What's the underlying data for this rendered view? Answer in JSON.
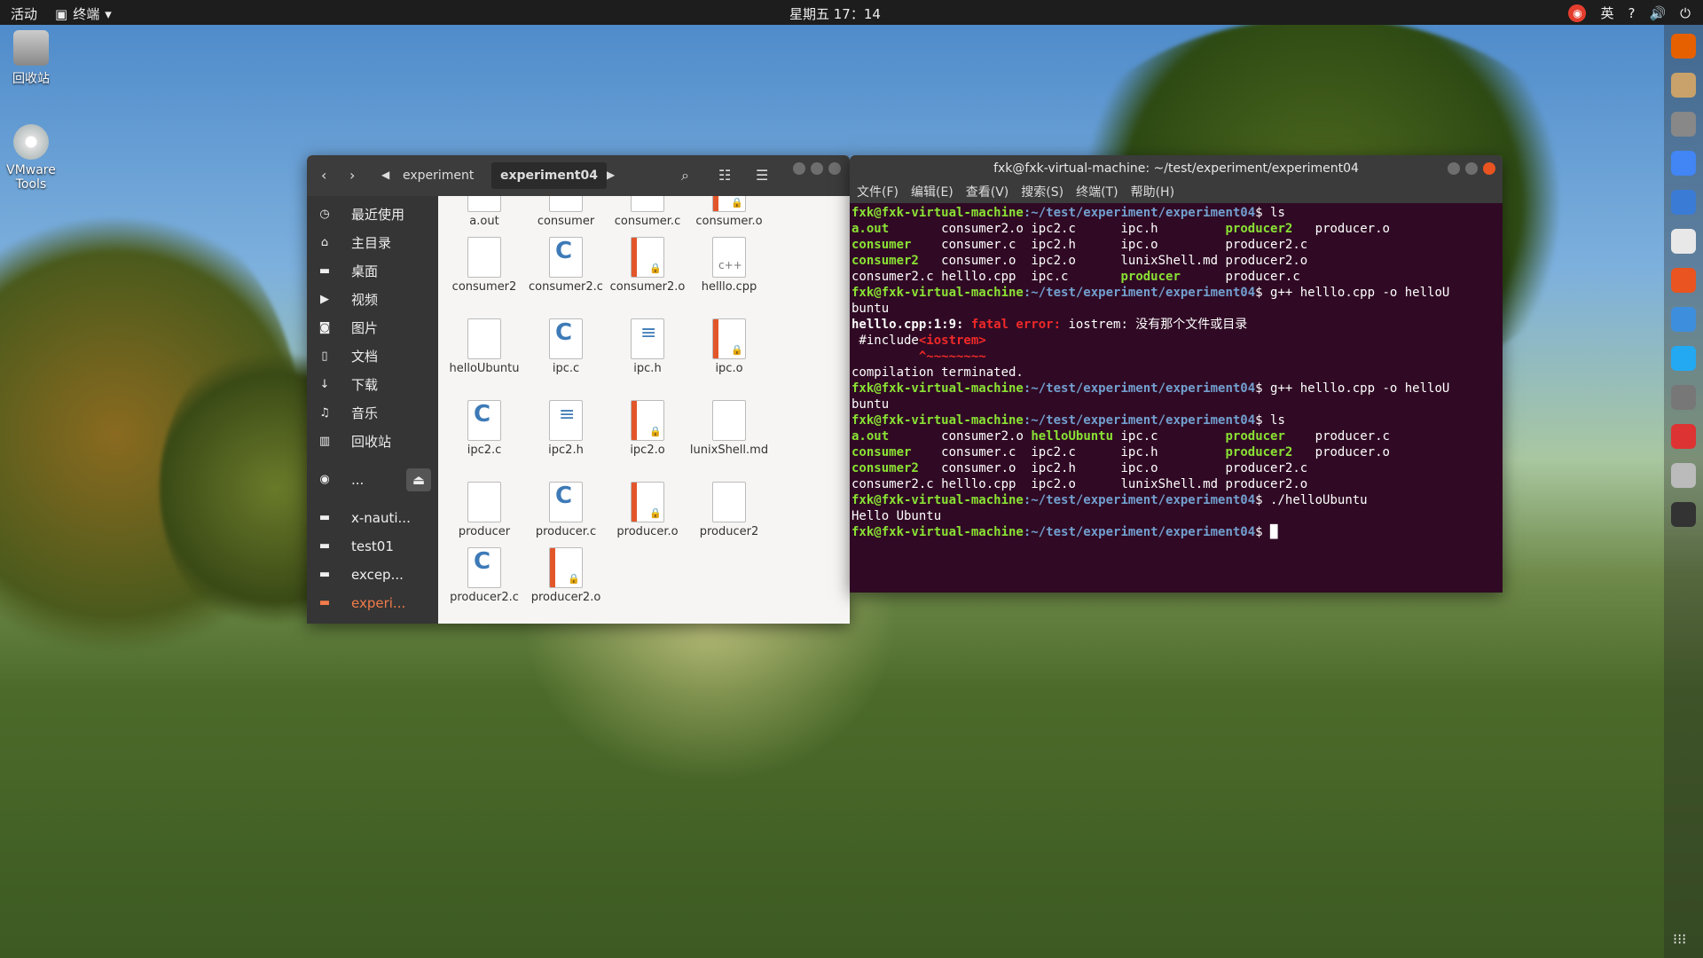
{
  "topbar": {
    "activities": "活动",
    "app_name": "终端",
    "clock": "星期五 17：14",
    "input_method": "英"
  },
  "desktop": {
    "trash_label": "回收站",
    "dvd_label": "VMware Tools"
  },
  "file_manager": {
    "breadcrumbs": [
      "experiment",
      "experiment04"
    ],
    "sidebar": [
      {
        "icon": "clock-icon",
        "glyph": "◷",
        "label": "最近使用"
      },
      {
        "icon": "home-icon",
        "glyph": "⌂",
        "label": "主目录"
      },
      {
        "icon": "folder-icon",
        "glyph": "▬",
        "label": "桌面"
      },
      {
        "icon": "video-icon",
        "glyph": "▶",
        "label": "视频"
      },
      {
        "icon": "camera-icon",
        "glyph": "◙",
        "label": "图片"
      },
      {
        "icon": "document-icon",
        "glyph": "▯",
        "label": "文档"
      },
      {
        "icon": "download-icon",
        "glyph": "↓",
        "label": "下载"
      },
      {
        "icon": "music-icon",
        "glyph": "♫",
        "label": "音乐"
      },
      {
        "icon": "trash-icon",
        "glyph": "▥",
        "label": "回收站"
      },
      {
        "icon": "disc-icon",
        "glyph": "◉",
        "label": "..."
      },
      {
        "icon": "folder-icon",
        "glyph": "▬",
        "label": "x-nauti..."
      },
      {
        "icon": "folder-icon",
        "glyph": "▬",
        "label": "test01"
      },
      {
        "icon": "folder-icon",
        "glyph": "▬",
        "label": "excep..."
      },
      {
        "icon": "folder-icon",
        "glyph": "▬",
        "label": "experi..."
      }
    ],
    "files": [
      {
        "name": "a.out",
        "type": "plain"
      },
      {
        "name": "consumer",
        "type": "plain"
      },
      {
        "name": "consumer.c",
        "type": "c"
      },
      {
        "name": "consumer.o",
        "type": "o"
      },
      {
        "name": "consumer2",
        "type": "plain"
      },
      {
        "name": "consumer2.c",
        "type": "c"
      },
      {
        "name": "consumer2.o",
        "type": "o"
      },
      {
        "name": "helllo.cpp",
        "type": "cpp"
      },
      {
        "name": "helloUbuntu",
        "type": "plain"
      },
      {
        "name": "ipc.c",
        "type": "c"
      },
      {
        "name": "ipc.h",
        "type": "h"
      },
      {
        "name": "ipc.o",
        "type": "o"
      },
      {
        "name": "ipc2.c",
        "type": "c"
      },
      {
        "name": "ipc2.h",
        "type": "h"
      },
      {
        "name": "ipc2.o",
        "type": "o"
      },
      {
        "name": "lunixShell.md",
        "type": "plain"
      },
      {
        "name": "producer",
        "type": "plain"
      },
      {
        "name": "producer.c",
        "type": "c"
      },
      {
        "name": "producer.o",
        "type": "o"
      },
      {
        "name": "producer2",
        "type": "plain"
      },
      {
        "name": "producer2.c",
        "type": "c"
      },
      {
        "name": "producer2.o",
        "type": "o"
      }
    ]
  },
  "terminal": {
    "title": "fxk@fxk-virtual-machine: ~/test/experiment/experiment04",
    "menu": [
      "文件(F)",
      "编辑(E)",
      "查看(V)",
      "搜索(S)",
      "终端(T)",
      "帮助(H)"
    ],
    "prompt_user": "fxk@fxk-virtual-machine",
    "prompt_path": ":~/test/experiment/experiment04",
    "lines": [
      {
        "kind": "cmd",
        "text": "$ ls"
      },
      {
        "kind": "ls",
        "cols": [
          [
            "a.out",
            "g"
          ],
          [
            "consumer2.o",
            ""
          ],
          [
            "ipc2.c",
            ""
          ],
          [
            "ipc.h",
            ""
          ],
          [
            "producer2",
            "g"
          ],
          [
            "producer.o",
            ""
          ]
        ]
      },
      {
        "kind": "ls",
        "cols": [
          [
            "consumer",
            "g"
          ],
          [
            "consumer.c",
            ""
          ],
          [
            "ipc2.h",
            ""
          ],
          [
            "ipc.o",
            ""
          ],
          [
            "producer2.c",
            ""
          ],
          [
            "",
            ""
          ]
        ]
      },
      {
        "kind": "ls",
        "cols": [
          [
            "consumer2",
            "g"
          ],
          [
            "consumer.o",
            ""
          ],
          [
            "ipc2.o",
            ""
          ],
          [
            "lunixShell.md",
            ""
          ],
          [
            "producer2.o",
            ""
          ],
          [
            "",
            ""
          ]
        ]
      },
      {
        "kind": "ls",
        "cols": [
          [
            "consumer2.c",
            ""
          ],
          [
            "helllo.cpp",
            ""
          ],
          [
            "ipc.c",
            ""
          ],
          [
            "producer",
            "g"
          ],
          [
            "producer.c",
            ""
          ],
          [
            "",
            ""
          ]
        ]
      },
      {
        "kind": "cmd",
        "text": "$ g++ helllo.cpp -o helloU"
      },
      {
        "kind": "plain",
        "text": "buntu"
      },
      {
        "kind": "err",
        "file": "helllo.cpp:1:9:",
        "label": "fatal error:",
        "msg": " iostrem: 没有那个文件或目录"
      },
      {
        "kind": "inc",
        "pre": " #include",
        "tok": "<iostrem>"
      },
      {
        "kind": "caret",
        "text": "         ^~~~~~~~~"
      },
      {
        "kind": "plain",
        "text": "compilation terminated."
      },
      {
        "kind": "cmd",
        "text": "$ g++ helllo.cpp -o helloU"
      },
      {
        "kind": "plain",
        "text": "buntu"
      },
      {
        "kind": "cmd",
        "text": "$ ls"
      },
      {
        "kind": "ls",
        "cols": [
          [
            "a.out",
            "g"
          ],
          [
            "consumer2.o",
            ""
          ],
          [
            "helloUbuntu",
            "g"
          ],
          [
            "ipc.c",
            ""
          ],
          [
            "producer",
            "g"
          ],
          [
            "producer.c",
            ""
          ]
        ]
      },
      {
        "kind": "ls",
        "cols": [
          [
            "consumer",
            "g"
          ],
          [
            "consumer.c",
            ""
          ],
          [
            "ipc2.c",
            ""
          ],
          [
            "ipc.h",
            ""
          ],
          [
            "producer2",
            "g"
          ],
          [
            "producer.o",
            ""
          ]
        ]
      },
      {
        "kind": "ls",
        "cols": [
          [
            "consumer2",
            "g"
          ],
          [
            "consumer.o",
            ""
          ],
          [
            "ipc2.h",
            ""
          ],
          [
            "ipc.o",
            ""
          ],
          [
            "producer2.c",
            ""
          ],
          [
            "",
            ""
          ]
        ]
      },
      {
        "kind": "ls",
        "cols": [
          [
            "consumer2.c",
            ""
          ],
          [
            "helllo.cpp",
            ""
          ],
          [
            "ipc2.o",
            ""
          ],
          [
            "lunixShell.md",
            ""
          ],
          [
            "producer2.o",
            ""
          ],
          [
            "",
            ""
          ]
        ]
      },
      {
        "kind": "cmd",
        "text": "$ ./helloUbuntu"
      },
      {
        "kind": "plain",
        "text": "Hello Ubuntu"
      },
      {
        "kind": "cmd",
        "text": "$ ",
        "cursor": true
      }
    ]
  }
}
